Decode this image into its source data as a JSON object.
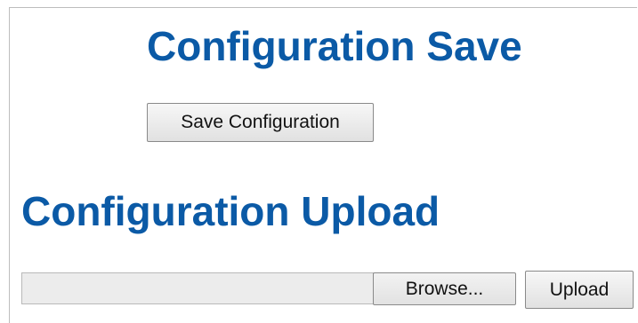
{
  "config_save": {
    "title": "Configuration Save",
    "button_label": "Save Configuration"
  },
  "config_upload": {
    "title": "Configuration Upload",
    "file_field_value": "",
    "browse_label": "Browse...",
    "upload_label": "Upload"
  },
  "colors": {
    "heading": "#0b5aa6",
    "frame_border": "#bdbdbd",
    "button_border": "#8a8a8a"
  }
}
